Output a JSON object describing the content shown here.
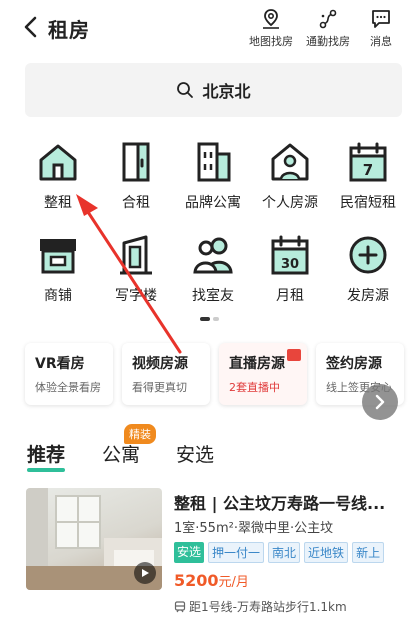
{
  "header": {
    "title": "租房",
    "actions": [
      {
        "label": "地图找房",
        "icon": "map-pin-icon"
      },
      {
        "label": "通勤找房",
        "icon": "route-icon"
      },
      {
        "label": "消息",
        "icon": "message-icon"
      }
    ]
  },
  "search": {
    "text": "北京北"
  },
  "categories": [
    {
      "label": "整租",
      "icon": "house-icon"
    },
    {
      "label": "合租",
      "icon": "door-icon"
    },
    {
      "label": "品牌公寓",
      "icon": "building-icon"
    },
    {
      "label": "个人房源",
      "icon": "person-home-icon"
    },
    {
      "label": "民宿短租",
      "icon": "calendar-7-icon"
    },
    {
      "label": "商铺",
      "icon": "shop-icon"
    },
    {
      "label": "写字楼",
      "icon": "office-tower-icon"
    },
    {
      "label": "找室友",
      "icon": "roommates-icon"
    },
    {
      "label": "月租",
      "icon": "calendar-30-icon"
    },
    {
      "label": "发房源",
      "icon": "plus-circle-icon"
    }
  ],
  "features": [
    {
      "title": "VR看房",
      "subtitle": "体验全景看房"
    },
    {
      "title": "视频房源",
      "subtitle": "看得更真切"
    },
    {
      "title": "直播房源",
      "subtitle": "2套直播中"
    },
    {
      "title": "签约房源",
      "subtitle": "线上签更安心"
    }
  ],
  "tabs": [
    {
      "label": "推荐"
    },
    {
      "label": "公寓"
    },
    {
      "label": "安选"
    }
  ],
  "tab_badge": "精装",
  "listing": {
    "title": "整租 | 公主坟万寿路一号线...",
    "meta": "1室·55m²·翠微中里·公主坟",
    "tags": [
      "安选",
      "押一付一",
      "南北",
      "近地铁",
      "新上"
    ],
    "price": "5200",
    "price_unit": "元/月",
    "metro": "距1号线-万寿路站步行1.1km"
  },
  "colors": {
    "accent": "#2fbf9a",
    "icon_fill": "#b7ecdc",
    "price": "#f05a28",
    "live": "#e03a3a",
    "annotation": "#e8332b"
  }
}
